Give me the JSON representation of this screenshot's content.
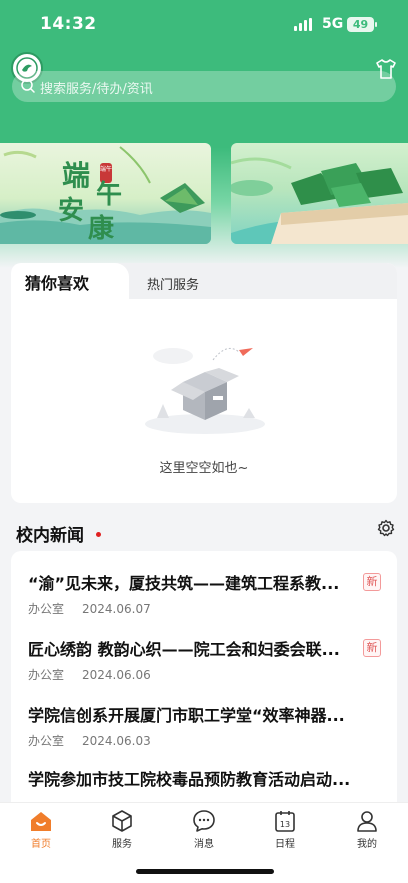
{
  "status_bar": {
    "time": "14:32",
    "network": "5G",
    "battery": "49"
  },
  "search": {
    "placeholder": "搜索服务/待办/资讯"
  },
  "banners": [
    {
      "art_text": [
        "端",
        "午",
        "安",
        "康"
      ],
      "seal_text": "端午"
    },
    {
      "art_text": []
    }
  ],
  "recommend": {
    "tabs": [
      {
        "label": "猜你喜欢",
        "active": true
      },
      {
        "label": "热门服务",
        "active": false
      }
    ],
    "empty_text": "这里空空如也~"
  },
  "news": {
    "title": "校内新闻",
    "items": [
      {
        "title": "“渝”见未来，厦技共筑——建筑工程系教...",
        "badge": "新",
        "source": "办公室",
        "date": "2024.06.07"
      },
      {
        "title": "匠心绣韵 教韵心织——院工会和妇委会联...",
        "badge": "新",
        "source": "办公室",
        "date": "2024.06.06"
      },
      {
        "title": "学院信创系开展厦门市职工学堂“效率神器...",
        "badge": "",
        "source": "办公室",
        "date": "2024.06.03"
      },
      {
        "title": "学院参加市技工院校毒品预防教育活动启动...",
        "badge": "",
        "source": "",
        "date": ""
      }
    ]
  },
  "bottom_nav": [
    {
      "label": "首页",
      "icon": "home-icon",
      "active": true
    },
    {
      "label": "服务",
      "icon": "cube-icon",
      "active": false
    },
    {
      "label": "消息",
      "icon": "message-icon",
      "active": false
    },
    {
      "label": "日程",
      "icon": "calendar-icon",
      "active": false,
      "icon_text": "13"
    },
    {
      "label": "我的",
      "icon": "user-icon",
      "active": false
    }
  ],
  "colors": {
    "brand_green": "#3dbb7c",
    "accent_orange": "#f07d2b",
    "badge_red": "#e05a5a"
  }
}
